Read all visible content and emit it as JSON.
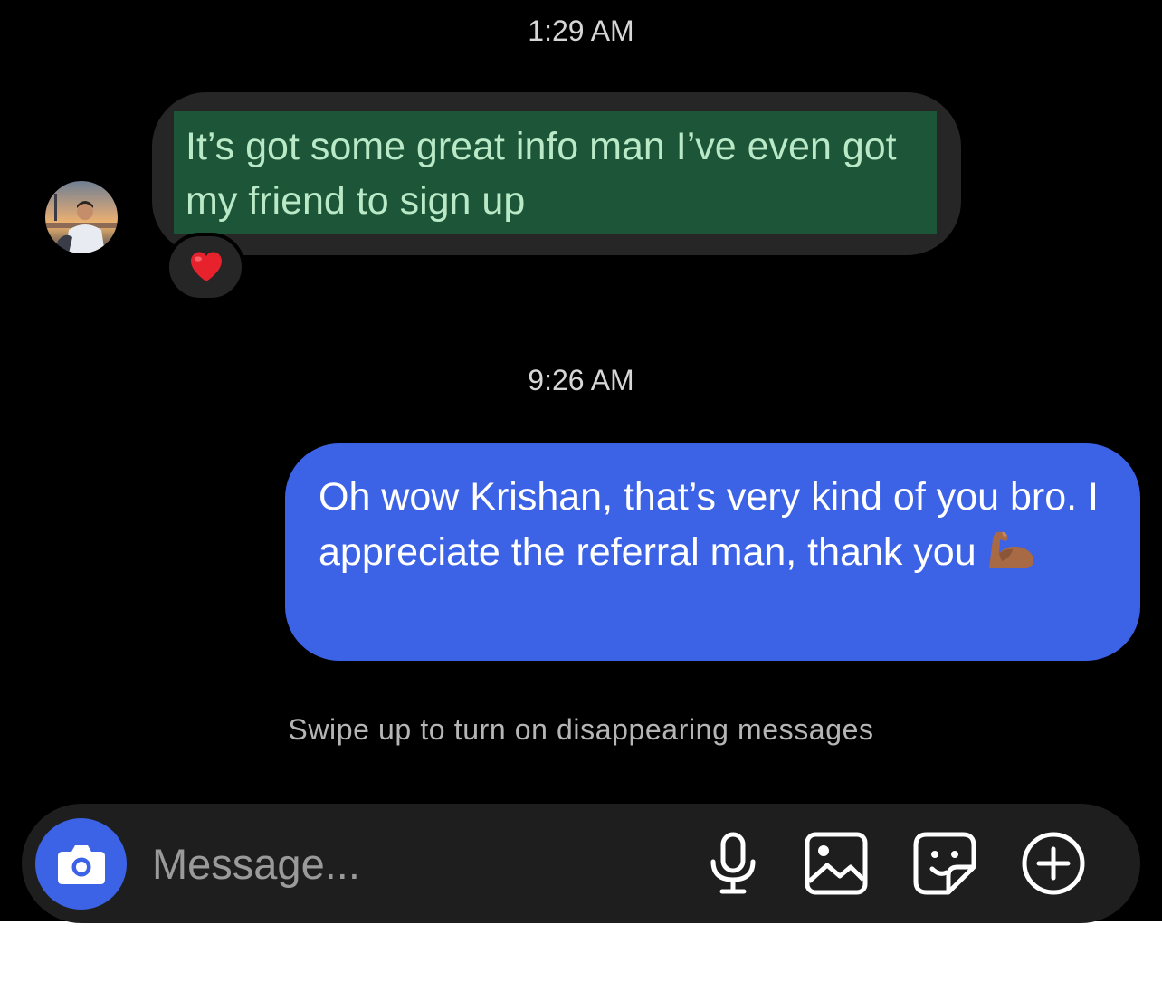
{
  "conversation": {
    "timestamps": [
      "1:29 AM",
      "9:26 AM"
    ],
    "incoming_message": {
      "text": "It’s got some great info man I’ve even got my friend to sign up",
      "highlight_color": "#1c5537",
      "reaction_icon": "red-heart-icon"
    },
    "outgoing_message": {
      "text": "Oh wow Krishan, that’s very kind of you bro. I appreciate the referral man, thank you",
      "emoji_icon": "flexed-biceps-icon",
      "bubble_color": "#3c62e6"
    },
    "disappearing_hint": "Swipe up to turn on disappearing messages"
  },
  "composer": {
    "placeholder": "Message...",
    "camera_icon": "camera-icon",
    "tools": [
      "microphone-icon",
      "gallery-icon",
      "sticker-icon",
      "add-icon"
    ],
    "accent_color": "#3c62e6"
  }
}
